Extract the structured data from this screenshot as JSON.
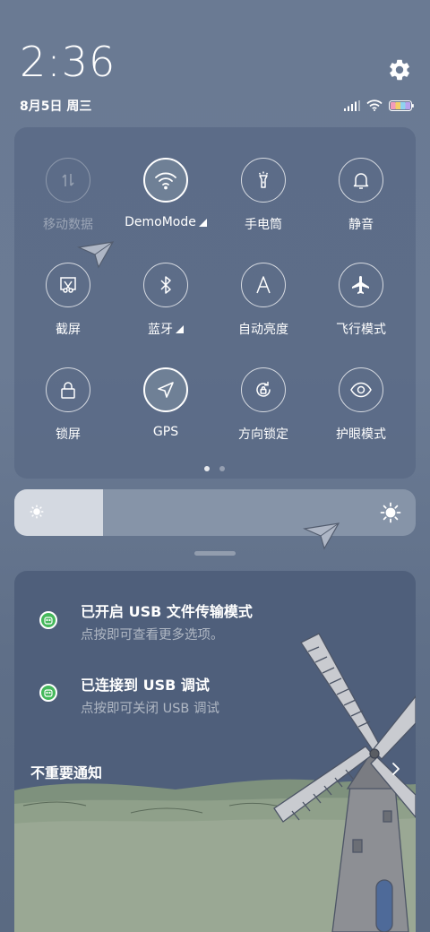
{
  "status": {
    "time": "2:36",
    "date": "8月5日 周三"
  },
  "quick_settings": {
    "tiles": [
      {
        "label": "移动数据",
        "icon": "mobile-data-icon",
        "state": "disabled"
      },
      {
        "label": "DemoMode",
        "icon": "wifi-icon",
        "state": "active",
        "expandable": true
      },
      {
        "label": "手电筒",
        "icon": "flashlight-icon",
        "state": "off"
      },
      {
        "label": "静音",
        "icon": "bell-icon",
        "state": "off"
      },
      {
        "label": "截屏",
        "icon": "screenshot-icon",
        "state": "off"
      },
      {
        "label": "蓝牙",
        "icon": "bluetooth-icon",
        "state": "off",
        "expandable": true
      },
      {
        "label": "自动亮度",
        "icon": "auto-brightness-icon",
        "state": "off"
      },
      {
        "label": "飞行模式",
        "icon": "airplane-icon",
        "state": "off"
      },
      {
        "label": "锁屏",
        "icon": "lock-icon",
        "state": "off"
      },
      {
        "label": "GPS",
        "icon": "gps-icon",
        "state": "active"
      },
      {
        "label": "方向锁定",
        "icon": "rotation-lock-icon",
        "state": "off"
      },
      {
        "label": "护眼模式",
        "icon": "eye-icon",
        "state": "off"
      }
    ],
    "page_current": 1,
    "page_count": 2
  },
  "brightness": {
    "level": 0.22
  },
  "notifications": [
    {
      "title": "已开启 USB 文件传输模式",
      "subtitle": "点按即可查看更多选项。"
    },
    {
      "title": "已连接到 USB 调试",
      "subtitle": "点按即可关闭 USB 调试"
    }
  ],
  "unimportant_label": "不重要通知",
  "colors": {
    "accent_green": "#45b85b",
    "panel": "#586884",
    "brightness_fill": "#d4d9e1"
  }
}
